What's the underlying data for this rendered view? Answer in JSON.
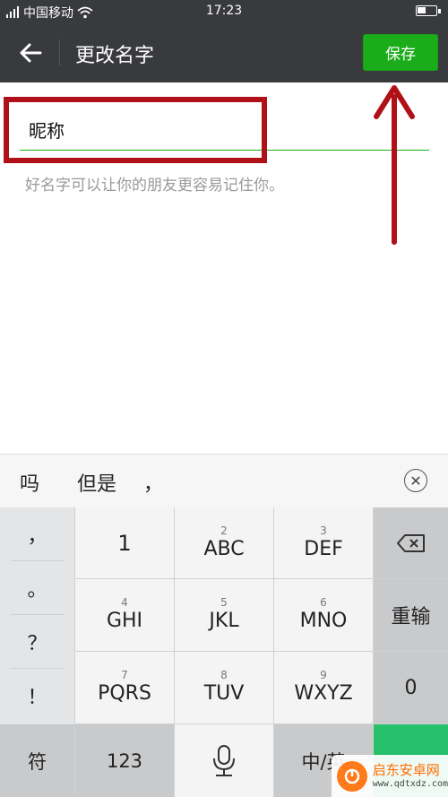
{
  "status_bar": {
    "carrier": "中国移动",
    "time": "17:23",
    "battery_level": 0.45
  },
  "header": {
    "title": "更改名字",
    "save_label": "保存"
  },
  "form": {
    "name_value": "昵称",
    "hint": "好名字可以让你的朋友更容易记住你。"
  },
  "suggestions": [
    "吗",
    "但是",
    "，"
  ],
  "keyboard": {
    "punctuation": [
      "，",
      "。",
      "？",
      "！"
    ],
    "rows": [
      [
        {
          "num": "",
          "label": "1"
        },
        {
          "num": "2",
          "label": "ABC"
        },
        {
          "num": "3",
          "label": "DEF"
        }
      ],
      [
        {
          "num": "4",
          "label": "GHI"
        },
        {
          "num": "5",
          "label": "JKL"
        },
        {
          "num": "6",
          "label": "MNO"
        }
      ],
      [
        {
          "num": "7",
          "label": "PQRS"
        },
        {
          "num": "8",
          "label": "TUV"
        },
        {
          "num": "9",
          "label": "WXYZ"
        }
      ]
    ],
    "reenter_label": "重输",
    "zero_label": "0",
    "symbol_label": "符",
    "numbers_label": "123",
    "lang_label": "中/英"
  },
  "watermark": {
    "title": "启东安卓网",
    "url": "www.qdtxdz.com"
  },
  "colors": {
    "accent": "#1aad19",
    "dark_bar": "#393a3e",
    "annotation_red": "#b01018",
    "enter_green": "#26c16a"
  }
}
